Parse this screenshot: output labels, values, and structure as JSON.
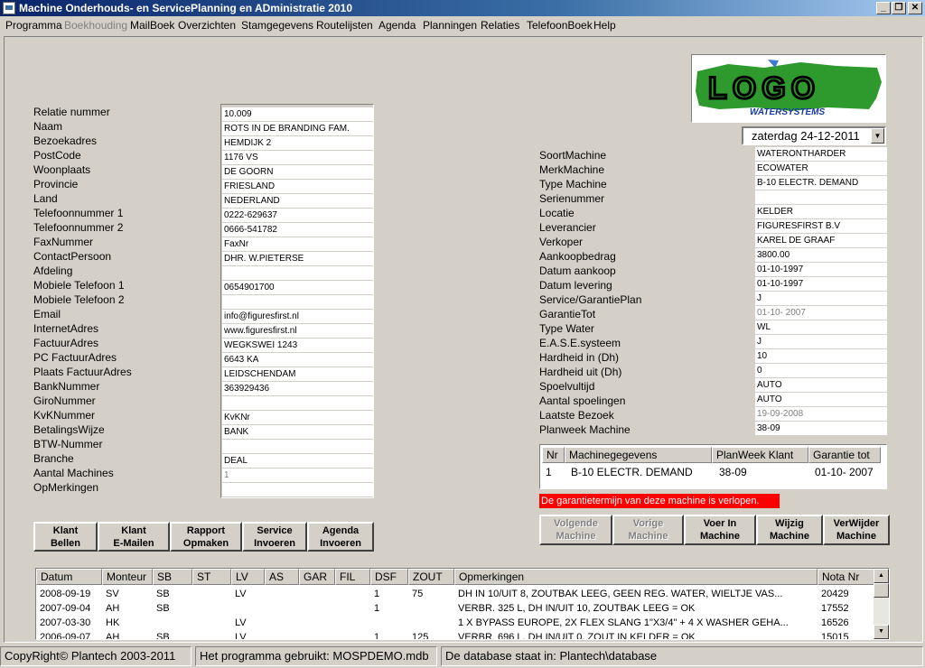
{
  "window": {
    "title": "Machine Onderhouds- en ServicePlanning  en ADministratie  2010",
    "minimize": "_",
    "maximize": "❐",
    "close": "✕"
  },
  "menu": [
    "Programma",
    "Boekhouding",
    "MailBoek",
    "Overzichten",
    "Stamgegevens",
    "Routelijsten",
    "Agenda",
    "Planningen",
    "Relaties",
    "TelefoonBoek",
    "Help"
  ],
  "relatie": {
    "labels": [
      "Relatie nummer",
      "Naam",
      "Bezoekadres",
      "PostCode",
      "Woonplaats",
      "Provincie",
      "Land",
      "Telefoonnummer 1",
      "Telefoonnummer 2",
      "FaxNummer",
      "ContactPersoon",
      "Afdeling",
      "Mobiele Telefoon 1",
      "Mobiele Telefoon 2",
      "Email",
      "InternetAdres",
      "FactuurAdres",
      "PC FactuurAdres",
      "Plaats FactuurAdres",
      "BankNummer",
      "GiroNummer",
      "KvKNummer",
      "BetalingsWijze",
      "BTW-Nummer",
      "Branche",
      "Aantal Machines",
      "OpMerkingen"
    ],
    "values": [
      "10.009",
      "ROTS IN DE BRANDING FAM.",
      "HEMDIJK 2",
      "1176 VS",
      "DE GOORN",
      "FRIESLAND",
      "NEDERLAND",
      "0222-629637",
      "0666-541782",
      "FaxNr",
      "DHR. W.PIETERSE",
      "",
      "0654901700",
      "",
      "info@figuresfirst.nl",
      "www.figuresfirst.nl",
      "WEGKSWEI 1243",
      "6643 KA",
      "LEIDSCHENDAM",
      "363929436",
      "",
      "KvKNr",
      "BANK",
      "",
      "DEAL",
      "1",
      ""
    ]
  },
  "logo": {
    "text": "LOGO",
    "subtext": "WATERSYSTEMS"
  },
  "date": {
    "value": "zaterdag  24-12-2011",
    "drop_icon": "▼"
  },
  "machine": {
    "labels": [
      "SoortMachine",
      "MerkMachine",
      "Type Machine",
      "Serienummer",
      "Locatie",
      "Leverancier",
      "Verkoper",
      "Aankoopbedrag",
      "Datum aankoop",
      "Datum levering",
      "Service/GarantiePlan",
      "GarantieTot",
      "Type Water",
      "E.A.S.E.systeem",
      "Hardheid in (Dh)",
      "Hardheid uit (Dh)",
      "Spoelvultijd",
      "Aantal spoelingen",
      "Laatste Bezoek",
      "Planweek Machine"
    ],
    "values": [
      "WATERONTHARDER",
      "ECOWATER",
      "B-10 ELECTR. DEMAND",
      "",
      "KELDER",
      "FIGURESFIRST B.V",
      "KAREL DE GRAAF",
      "3800.00",
      "01-10-1997",
      "01-10-1997",
      "J",
      "01-10- 2007",
      "WL",
      "J",
      "10",
      "0",
      "AUTO",
      "AUTO",
      "19-09-2008",
      "38-09"
    ]
  },
  "machine_grid": {
    "headers": [
      "Nr",
      "Machinegegevens",
      "PlanWeek Klant",
      "Garantie tot"
    ],
    "rows": [
      [
        "1",
        "B-10 ELECTR. DEMAND",
        "38-09",
        "01-10- 2007"
      ]
    ]
  },
  "warning": "De garantietermijn van deze machine is verlopen.",
  "left_buttons": [
    [
      "Klant",
      "Bellen"
    ],
    [
      "Klant",
      "E-Mailen"
    ],
    [
      "Rapport",
      "Opmaken"
    ],
    [
      "Service",
      "Invoeren"
    ],
    [
      "Agenda",
      "Invoeren"
    ]
  ],
  "right_buttons": [
    [
      "Volgende",
      "Machine"
    ],
    [
      "Vorige",
      "Machine"
    ],
    [
      "Voer In",
      "Machine"
    ],
    [
      "Wijzig",
      "Machine"
    ],
    [
      "VerWijder",
      "Machine"
    ]
  ],
  "visits": {
    "headers": [
      "Datum",
      "Monteur",
      "SB",
      "ST",
      "LV",
      "AS",
      "GAR",
      "FIL",
      "DSF",
      "ZOUT",
      "Opmerkingen",
      "Nota Nr"
    ],
    "rows": [
      [
        "2008-09-19",
        "SV",
        "SB",
        "",
        "LV",
        "",
        "",
        "",
        "1",
        "75",
        "DH IN 10/UIT 8, ZOUTBAK LEEG, GEEN REG. WATER, WIELTJE VAS...",
        "20429"
      ],
      [
        "2007-09-04",
        "AH",
        "SB",
        "",
        "",
        "",
        "",
        "",
        "1",
        "",
        "VERBR. 325 L, DH IN/UIT 10, ZOUTBAK LEEG = OK",
        "17552"
      ],
      [
        "2007-03-30",
        "HK",
        "",
        "",
        "LV",
        "",
        "",
        "",
        "",
        "",
        "1 X BYPASS EUROPE, 2X FLEX SLANG 1\"X3/4\" + 4 X WASHER GEHA...",
        "16526"
      ],
      [
        "2006-09-07",
        "AH",
        "SB",
        "",
        "LV",
        "",
        "",
        "",
        "1",
        "125",
        "VERBR. 696 L, DH IN/UIT 0, ZOUT IN KELDER = OK",
        "15015"
      ]
    ],
    "scroll_up": "▲",
    "scroll_down": "▼"
  },
  "status": {
    "copyright": "CopyRight© Plantech 2003-2011",
    "program": "Het programma gebruikt: MOSPDEMO.mdb",
    "database": "De database staat in: Plantech\\database"
  }
}
